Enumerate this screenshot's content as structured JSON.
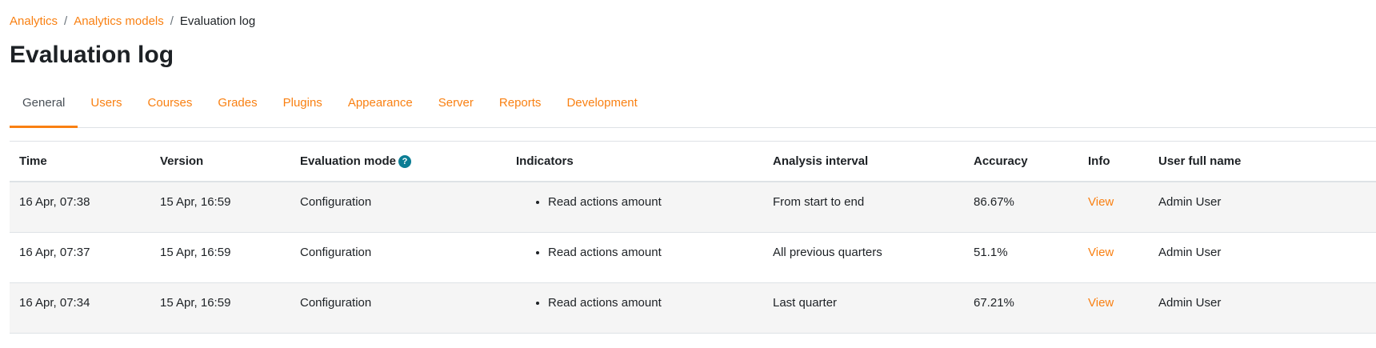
{
  "breadcrumb": {
    "items": [
      "Analytics",
      "Analytics models"
    ],
    "separator": "/",
    "current": "Evaluation log"
  },
  "page_title": "Evaluation log",
  "tabs": [
    {
      "label": "General",
      "active": true
    },
    {
      "label": "Users"
    },
    {
      "label": "Courses"
    },
    {
      "label": "Grades"
    },
    {
      "label": "Plugins"
    },
    {
      "label": "Appearance"
    },
    {
      "label": "Server"
    },
    {
      "label": "Reports"
    },
    {
      "label": "Development"
    }
  ],
  "table": {
    "headers": [
      "Time",
      "Version",
      "Evaluation mode",
      "Indicators",
      "Analysis interval",
      "Accuracy",
      "Info",
      "User full name"
    ],
    "help_icon": "?",
    "rows": [
      {
        "time": "16 Apr, 07:38",
        "version": "15 Apr, 16:59",
        "mode": "Configuration",
        "indicator": "Read actions amount",
        "interval": "From start to end",
        "accuracy": "86.67%",
        "info": "View",
        "user": "Admin User"
      },
      {
        "time": "16 Apr, 07:37",
        "version": "15 Apr, 16:59",
        "mode": "Configuration",
        "indicator": "Read actions amount",
        "interval": "All previous quarters",
        "accuracy": "51.1%",
        "info": "View",
        "user": "Admin User"
      },
      {
        "time": "16 Apr, 07:34",
        "version": "15 Apr, 16:59",
        "mode": "Configuration",
        "indicator": "Read actions amount",
        "interval": "Last quarter",
        "accuracy": "67.21%",
        "info": "View",
        "user": "Admin User"
      }
    ]
  },
  "colors": {
    "link": "#f98012",
    "text": "#1d2125",
    "stripe": "#f5f5f5",
    "help_icon": "#0b7d94"
  }
}
